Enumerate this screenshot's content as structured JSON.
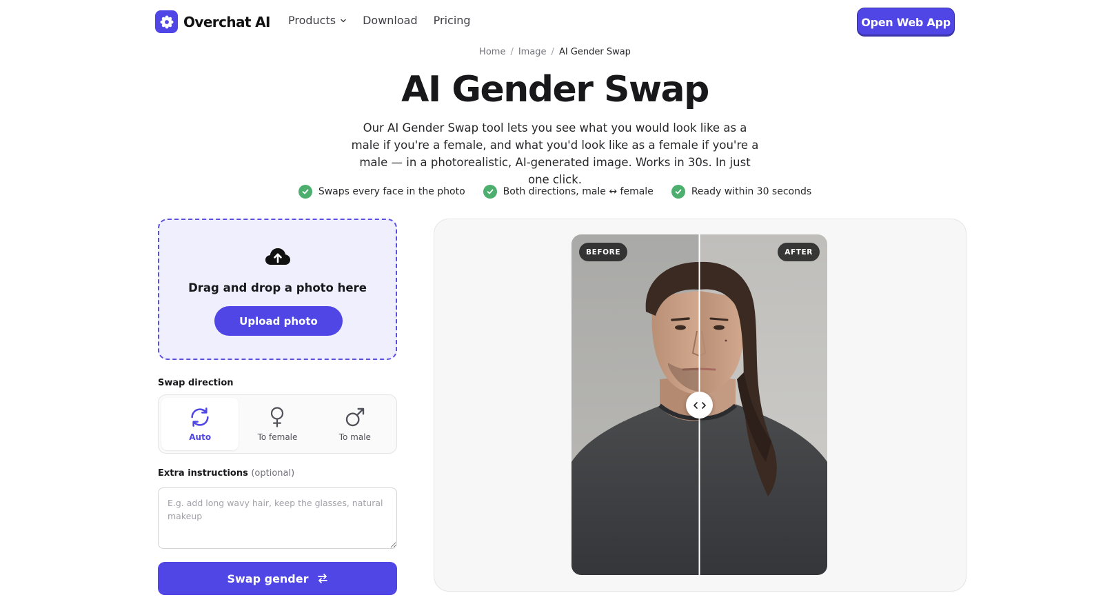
{
  "nav": {
    "brand": "Overchat AI",
    "links": [
      {
        "label": "Products",
        "has_dropdown": true
      },
      {
        "label": "Download"
      },
      {
        "label": "Pricing"
      }
    ],
    "cta": "Open Web App"
  },
  "breadcrumb": [
    "Home",
    "Image",
    "AI Gender Swap"
  ],
  "hero": {
    "title": "AI Gender Swap",
    "subtitle": "Our AI Gender Swap tool lets you see what you would look like as a male if you're a female, and what you'd look like as a female if you're a male — in a photorealistic, AI-generated image. Works in 30s. In just one click.",
    "features": [
      "Swaps every face in the photo",
      "Both directions, male ↔ female",
      "Ready within 30 seconds"
    ]
  },
  "upload": {
    "prompt": "Drag and drop a photo here",
    "button": "Upload photo",
    "icon": "cloud-upload-icon"
  },
  "swap_direction": {
    "label": "Swap direction",
    "options": [
      {
        "label": "Auto",
        "icon": "refresh-icon",
        "selected": true
      },
      {
        "label": "To female",
        "icon": "female-symbol-icon",
        "selected": false
      },
      {
        "label": "To male",
        "icon": "male-symbol-icon",
        "selected": false
      }
    ]
  },
  "instructions": {
    "label": "Extra instructions",
    "optional": "(optional)",
    "placeholder": "E.g. add long wavy hair, keep the glasses, natural makeup",
    "value": ""
  },
  "action": {
    "label": "Swap gender",
    "icon": "swap-arrows-icon"
  },
  "preview": {
    "before_label": "BEFORE",
    "after_label": "AFTER",
    "slider_position": 0.5
  },
  "colors": {
    "accent": "#4f46e5",
    "dropzone_bg": "#f0effd",
    "check_green": "#4caf6e",
    "preview_bg": "#f7f7f8"
  }
}
